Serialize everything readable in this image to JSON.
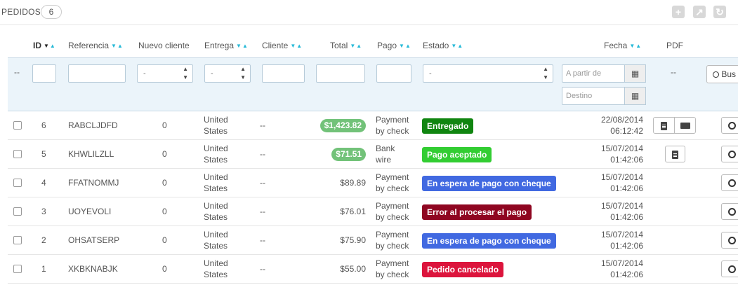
{
  "header": {
    "title": "PEDIDOS",
    "count": "6"
  },
  "toolbar": {
    "add_icon": "plus-icon",
    "export_icon": "export-icon",
    "refresh_icon": "refresh-icon"
  },
  "columns": {
    "id": "ID",
    "ref": "Referencia",
    "new_customer": "Nuevo cliente",
    "delivery": "Entrega",
    "customer": "Cliente",
    "total": "Total",
    "payment": "Pago",
    "status": "Estado",
    "date": "Fecha",
    "pdf": "PDF"
  },
  "filters": {
    "dash": "--",
    "select_placeholder": "-",
    "date_from": "A partir de",
    "date_to": "Destino",
    "pdf_dash": "--",
    "search_label": "Bus"
  },
  "orders": [
    {
      "id": "6",
      "ref": "RABCLJDFD",
      "new": "0",
      "delivery1": "United",
      "delivery2": "States",
      "customer": "--",
      "total": "$1,423.82",
      "total_badge": true,
      "pay1": "Payment",
      "pay2": "by check",
      "status": "Entregado",
      "status_color": "#108510",
      "date1": "22/08/2014",
      "date2": "06:12:42",
      "pdf": "invoice-delivery"
    },
    {
      "id": "5",
      "ref": "KHWLILZLL",
      "new": "0",
      "delivery1": "United",
      "delivery2": "States",
      "customer": "--",
      "total": "$71.51",
      "total_badge": true,
      "pay1": "Bank",
      "pay2": "wire",
      "status": "Pago aceptado",
      "status_color": "#32cd32",
      "date1": "15/07/2014",
      "date2": "01:42:06",
      "pdf": "invoice"
    },
    {
      "id": "4",
      "ref": "FFATNOMMJ",
      "new": "0",
      "delivery1": "United",
      "delivery2": "States",
      "customer": "--",
      "total": "$89.89",
      "total_badge": false,
      "pay1": "Payment",
      "pay2": "by check",
      "status": "En espera de pago con cheque",
      "status_color": "#4169e1",
      "date1": "15/07/2014",
      "date2": "01:42:06",
      "pdf": ""
    },
    {
      "id": "3",
      "ref": "UOYEVOLI",
      "new": "0",
      "delivery1": "United",
      "delivery2": "States",
      "customer": "--",
      "total": "$76.01",
      "total_badge": false,
      "pay1": "Payment",
      "pay2": "by check",
      "status": "Error al procesar el pago",
      "status_color": "#8f0621",
      "date1": "15/07/2014",
      "date2": "01:42:06",
      "pdf": ""
    },
    {
      "id": "2",
      "ref": "OHSATSERP",
      "new": "0",
      "delivery1": "United",
      "delivery2": "States",
      "customer": "--",
      "total": "$75.90",
      "total_badge": false,
      "pay1": "Payment",
      "pay2": "by check",
      "status": "En espera de pago con cheque",
      "status_color": "#4169e1",
      "date1": "15/07/2014",
      "date2": "01:42:06",
      "pdf": ""
    },
    {
      "id": "1",
      "ref": "XKBKNABJK",
      "new": "0",
      "delivery1": "United",
      "delivery2": "States",
      "customer": "--",
      "total": "$55.00",
      "total_badge": false,
      "pay1": "Payment",
      "pay2": "by check",
      "status": "Pedido cancelado",
      "status_color": "#dc143c",
      "date1": "15/07/2014",
      "date2": "01:42:06",
      "pdf": ""
    }
  ]
}
